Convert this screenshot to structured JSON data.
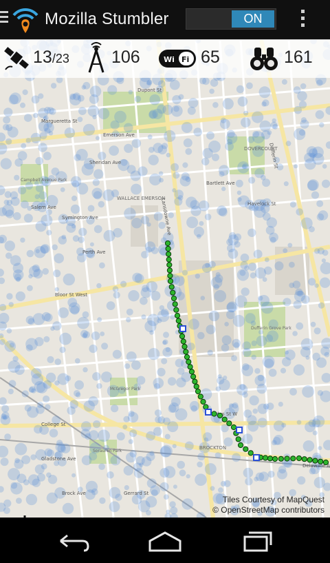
{
  "app": {
    "title": "Mozilla Stumbler",
    "toggle_label": "ON"
  },
  "stats": {
    "satellites_used": "13",
    "satellites_total": "/23",
    "cell_towers": "106",
    "wifi_count": "65",
    "wifi_icon_text": "Wi Fi",
    "observations": "161"
  },
  "map": {
    "attribution_line1": "Tiles Courtesy of MapQuest",
    "attribution_line2": "© OpenStreetMap contributors",
    "street_labels": [
      "Dupont St",
      "Bloor St West",
      "Dundas St W",
      "College St",
      "Lansdowne Ave",
      "Dufferin St",
      "Gladstone Ave",
      "Brock Ave",
      "Sheridan Ave",
      "Margueretta St",
      "Bartlett Ave",
      "Havelock St",
      "Salem Ave",
      "Gerrard St",
      "Perth Ave",
      "Symington Ave",
      "Emerson Ave",
      "Delaware Ave"
    ],
    "area_labels": [
      "WALLACE EMERSON",
      "DOVERCOURT",
      "BROCKTON",
      "Dufferin Grove Park",
      "McGregor Park",
      "Campbell Avenue Park",
      "Sorauren Park"
    ]
  },
  "colors": {
    "appbar": "#101010",
    "accent": "#2f88b8",
    "track_point": "#2db52d",
    "track_marker": "#2a4fd6"
  }
}
